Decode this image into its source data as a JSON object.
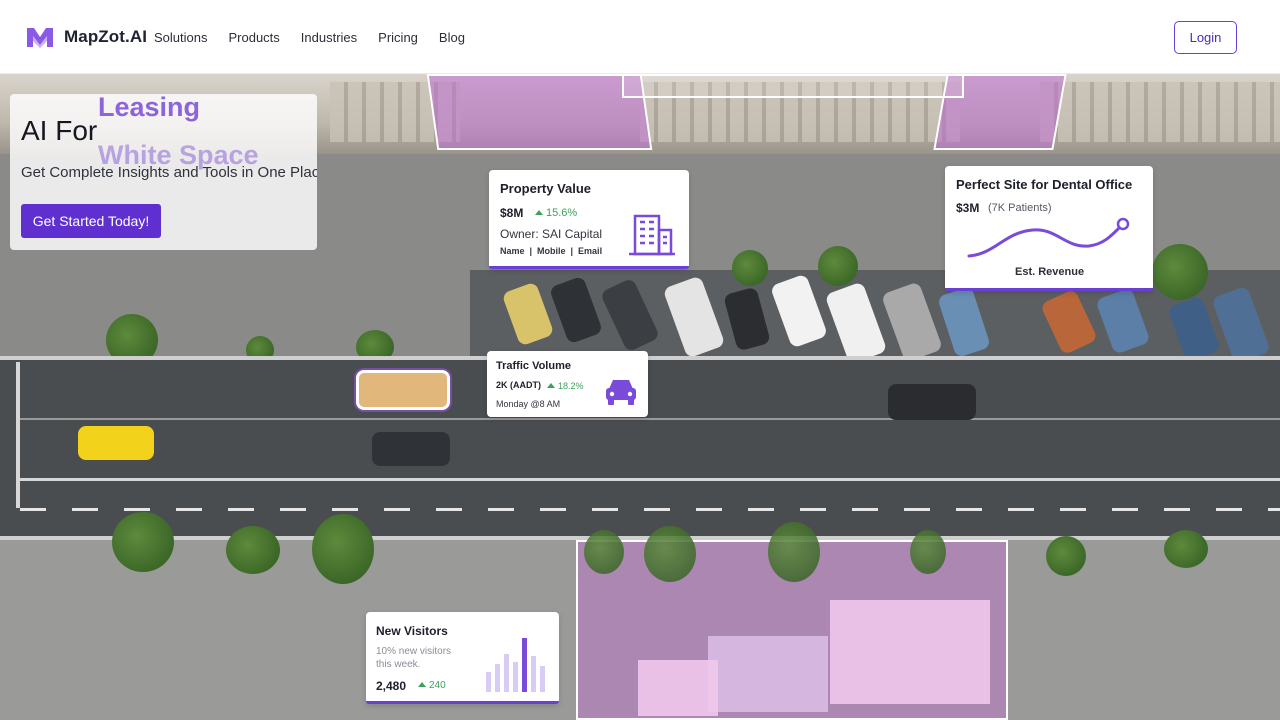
{
  "header": {
    "brand": "MapZot.AI",
    "nav_items": [
      "Solutions",
      "Products",
      "Industries",
      "Pricing",
      "Blog"
    ],
    "login_label": "Login"
  },
  "hero": {
    "title": "AI For",
    "rotating_word_1": "Leasing",
    "rotating_word_2": "White Space",
    "subtitle": "Get Complete Insights and Tools in One Place",
    "cta_label": "Get Started Today!"
  },
  "cards": {
    "property": {
      "title": "Property Value",
      "value": "$8M",
      "change": "15.6%",
      "owner": "Owner: SAI Capital",
      "links": "Name  |  Mobile  |  Email",
      "icon": "building-icon"
    },
    "dental": {
      "title": "Perfect Site for Dental Office",
      "value": "$3M",
      "patients": "(7K Patients)",
      "caption": "Est. Revenue",
      "icon": "trend-line-icon"
    },
    "traffic": {
      "title": "Traffic Volume",
      "value": "2K (AADT)",
      "change": "18.2%",
      "time": "Monday @8 AM",
      "icon": "car-icon"
    },
    "visitors": {
      "title": "New Visitors",
      "description_1": "10% new visitors",
      "description_2": "this week.",
      "value": "2,480",
      "change": "240",
      "icon": "bar-chart-icon"
    }
  },
  "colors": {
    "accent": "#6a3fd3",
    "positive": "#3aa35a",
    "highlight": "#be6ed2"
  }
}
